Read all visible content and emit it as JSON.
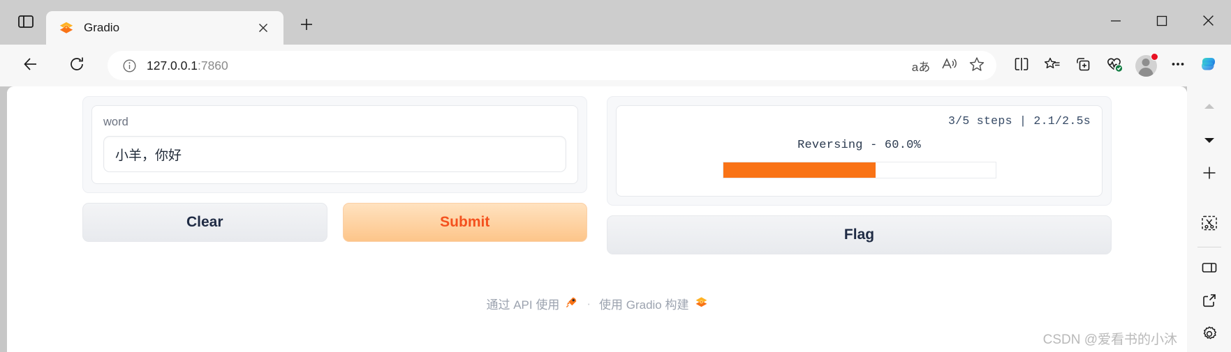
{
  "browser": {
    "tab": {
      "title": "Gradio",
      "favicon_icon": "gradio-logo-icon",
      "close_icon": "close-icon"
    },
    "tab_search_icon": "tab-search-icon",
    "new_tab_icon": "plus-icon",
    "window_controls": [
      {
        "name": "minimize-button",
        "icon": "minimize-icon"
      },
      {
        "name": "maximize-button",
        "icon": "maximize-icon"
      },
      {
        "name": "close-window-button",
        "icon": "close-icon"
      }
    ],
    "toolbar": {
      "back_icon": "back-arrow-icon",
      "reload_icon": "reload-icon",
      "info_icon": "info-circle-icon",
      "url_host": "127.0.0.1",
      "url_port": ":7860",
      "omnibox_actions": [
        {
          "name": "translate-button",
          "icon": "translate-icon",
          "label": "aあ"
        },
        {
          "name": "read-aloud-button",
          "icon": "read-aloud-icon"
        },
        {
          "name": "add-favorite-button",
          "icon": "star-icon"
        }
      ],
      "right_actions": [
        {
          "name": "split-screen-button",
          "icon": "split-screen-icon"
        },
        {
          "name": "favorites-button",
          "icon": "favorites-list-icon"
        },
        {
          "name": "collections-button",
          "icon": "collections-icon"
        },
        {
          "name": "browser-essentials-button",
          "icon": "browser-essentials-icon"
        }
      ],
      "profile": {
        "name": "profile-avatar",
        "icon": "avatar-icon",
        "has_notification": true
      },
      "settings_more_icon": "ellipsis-icon",
      "copilot_icon": "copilot-icon"
    },
    "sidebar": [
      {
        "name": "sidebar-scroll-up",
        "icon": "chevron-up-icon"
      },
      {
        "name": "sidebar-scroll-down",
        "icon": "chevron-down-icon"
      },
      {
        "name": "sidebar-add-tool",
        "icon": "plus-icon"
      },
      {
        "name": "sidebar-screenshot",
        "icon": "screenshot-scissors-icon"
      },
      {
        "name": "sidebar-split-pane",
        "icon": "split-pane-icon"
      },
      {
        "name": "sidebar-open-external",
        "icon": "external-link-icon"
      },
      {
        "name": "sidebar-settings",
        "icon": "gear-icon"
      }
    ]
  },
  "app": {
    "input": {
      "label": "word",
      "value": "小羊，你好",
      "placeholder": ""
    },
    "status": {
      "steps_text": "3/5 steps | 2.1/2.5s",
      "progress_label": "Reversing - 60.0%",
      "progress_percent": 56,
      "progress_color": "#f97316",
      "track_color": "#ffffff"
    },
    "buttons": {
      "clear": "Clear",
      "submit": "Submit",
      "flag": "Flag"
    },
    "footer": {
      "api_text": "通过 API 使用",
      "rocket_icon": "rocket-icon",
      "separator": "·",
      "built_with_text": "使用 Gradio 构建",
      "gradio_icon": "gradio-logo-icon"
    }
  },
  "watermark": "CSDN @爱看书的小沐"
}
